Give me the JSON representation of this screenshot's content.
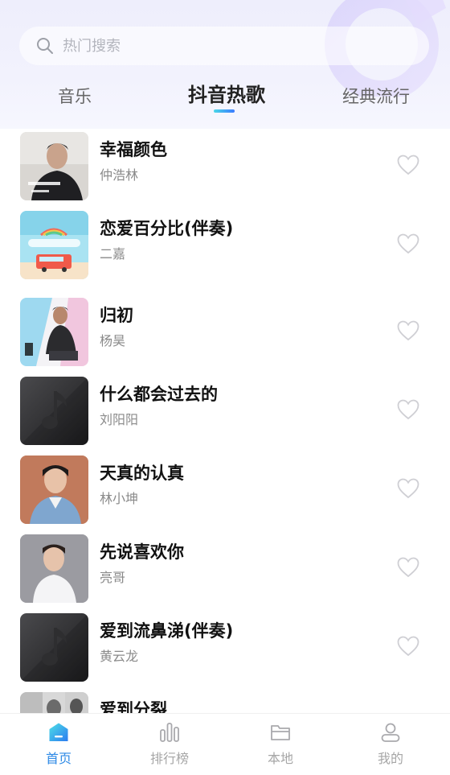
{
  "search": {
    "placeholder": "热门搜索"
  },
  "tabs": [
    {
      "label": "音乐",
      "active": false
    },
    {
      "label": "抖音热歌",
      "active": true
    },
    {
      "label": "经典流行",
      "active": false
    }
  ],
  "songs": [
    {
      "title": "幸福颜色",
      "artist": "仲浩林",
      "cover": "artist-portrait-cover"
    },
    {
      "title": "恋爱百分比(伴奏)",
      "artist": "二嘉",
      "cover": "beach-bus-cover"
    },
    {
      "title": "归初",
      "artist": "杨昊",
      "cover": "artist-portrait-cover"
    },
    {
      "title": "什么都会过去的",
      "artist": "刘阳阳",
      "cover": "default-music-note-cover"
    },
    {
      "title": "天真的认真",
      "artist": "林小坤",
      "cover": "artist-portrait-cover"
    },
    {
      "title": "先说喜欢你",
      "artist": "亮哥",
      "cover": "artist-portrait-cover"
    },
    {
      "title": "爱到流鼻涕(伴奏)",
      "artist": "黄云龙",
      "cover": "default-music-note-cover"
    },
    {
      "title": "爱到分裂",
      "artist": "",
      "cover": "artist-portrait-cover"
    }
  ],
  "bottom_nav": [
    {
      "label": "首页",
      "icon": "home-icon",
      "active": true
    },
    {
      "label": "排行榜",
      "icon": "chart-bars-icon",
      "active": false
    },
    {
      "label": "本地",
      "icon": "folder-icon",
      "active": false
    },
    {
      "label": "我的",
      "icon": "user-icon",
      "active": false
    }
  ],
  "colors": {
    "accent": "#2e8ae6",
    "tab_indicator_start": "#4ad8e8",
    "tab_indicator_end": "#3b7bff",
    "background_top": "#eeeefc"
  }
}
